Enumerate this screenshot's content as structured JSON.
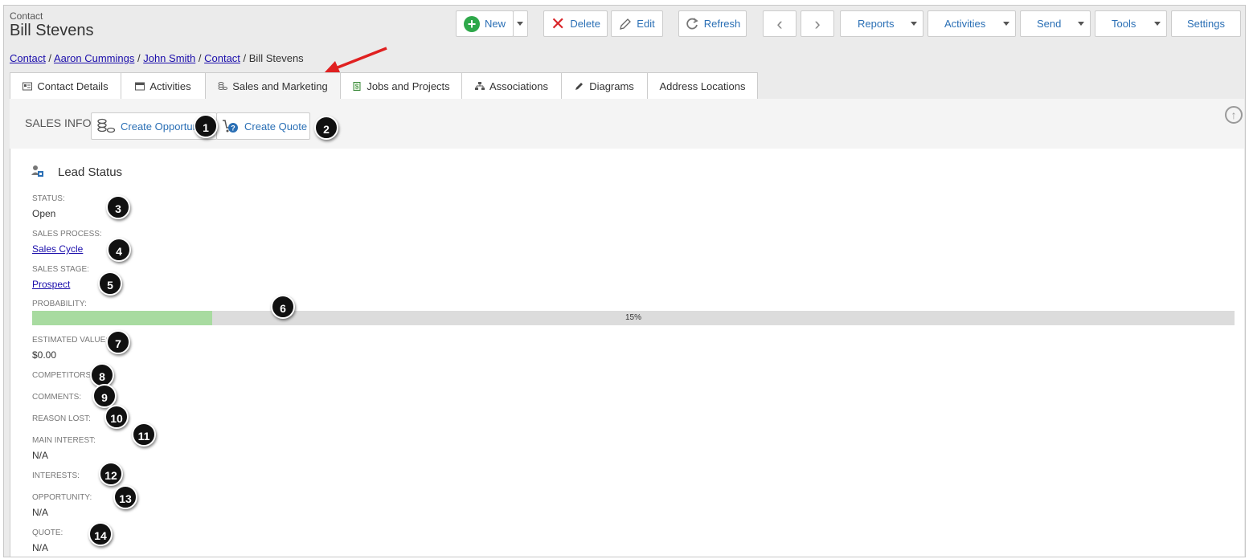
{
  "header": {
    "entity_type": "Contact",
    "entity_name": "Bill Stevens"
  },
  "toolbar": {
    "new_label": "New",
    "delete_label": "Delete",
    "edit_label": "Edit",
    "refresh_label": "Refresh",
    "reports_label": "Reports",
    "activities_label": "Activities",
    "send_label": "Send",
    "tools_label": "Tools",
    "settings_label": "Settings"
  },
  "breadcrumb": {
    "items": [
      "Contact",
      "Aaron Cummings",
      "John Smith",
      "Contact"
    ],
    "current": "Bill Stevens",
    "separator": " / "
  },
  "tabs": [
    {
      "label": "Contact Details",
      "icon": "id-card-icon"
    },
    {
      "label": "Activities",
      "icon": "calendar-icon"
    },
    {
      "label": "Sales and Marketing",
      "icon": "coins-icon",
      "active": true
    },
    {
      "label": "Jobs and Projects",
      "icon": "document-dollar-icon"
    },
    {
      "label": "Associations",
      "icon": "org-chart-icon"
    },
    {
      "label": "Diagrams",
      "icon": "pencil-icon"
    },
    {
      "label": "Address Locations",
      "icon": ""
    }
  ],
  "sales_info": {
    "label": "SALES INFO",
    "create_opportunity_label": "Create Opportunity",
    "create_quote_label": "Create Quote"
  },
  "lead_status": {
    "title": "Lead Status",
    "status_label": "STATUS:",
    "status_value": "Open",
    "sales_process_label": "SALES PROCESS:",
    "sales_process_value": "Sales Cycle",
    "sales_stage_label": "SALES STAGE:",
    "sales_stage_value": "Prospect",
    "probability_label": "PROBABILITY:",
    "probability_value": 15,
    "probability_text": "15%",
    "estimated_value_label": "ESTIMATED VALUE:",
    "estimated_value": "$0.00",
    "competitors_label": "COMPETITORS:",
    "comments_label": "COMMENTS:",
    "reason_lost_label": "REASON LOST:",
    "main_interest_label": "MAIN INTEREST:",
    "main_interest_value": "N/A",
    "interests_label": "INTERESTS:",
    "opportunity_label": "OPPORTUNITY:",
    "opportunity_value": "N/A",
    "quote_label": "QUOTE:",
    "quote_value": "N/A"
  },
  "annotations": [
    "1",
    "2",
    "3",
    "4",
    "5",
    "6",
    "7",
    "8",
    "9",
    "10",
    "11",
    "12",
    "13",
    "14"
  ],
  "colors": {
    "accent": "#2a6fb5",
    "progress_fill": "#a8dba0",
    "delete": "#d9262a",
    "new": "#2ea84a",
    "callout_arrow": "#e02020"
  }
}
